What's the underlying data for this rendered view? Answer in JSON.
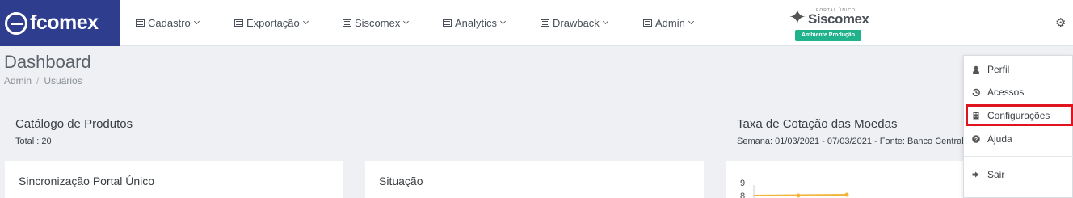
{
  "brand": {
    "logo_text": "fcomex"
  },
  "nav": [
    {
      "label": "Cadastro"
    },
    {
      "label": "Exportação"
    },
    {
      "label": "Siscomex"
    },
    {
      "label": "Analytics"
    },
    {
      "label": "Drawback"
    },
    {
      "label": "Admin"
    }
  ],
  "siscomex": {
    "portal_label": "PORTAL ÚNICO",
    "name": "Siscomex",
    "badge": "Ambiente Produção",
    "badge_color": "#20b28a"
  },
  "settings": {
    "icon": "gear-icon"
  },
  "page": {
    "title": "Dashboard",
    "breadcrumb": [
      "Admin",
      "Usuários"
    ],
    "breadcrumb_sep": "/"
  },
  "catalog": {
    "title": "Catálogo de Produtos",
    "total": "Total : 20"
  },
  "currency": {
    "title": "Taxa de Cotação das Moedas",
    "subtitle": "Semana: 01/03/2021 - 07/03/2021 - Fonte: Banco Central"
  },
  "cards": {
    "sync": {
      "title": "Sincronização Portal Único"
    },
    "status": {
      "title": "Situação"
    },
    "chart_tick_top": "9",
    "chart_tick_next": "8"
  },
  "menu": {
    "items": [
      {
        "label": "Perfil",
        "icon": "user-icon"
      },
      {
        "label": "Acessos",
        "icon": "history-icon"
      },
      {
        "label": "Configurações",
        "icon": "config-icon",
        "highlighted": true
      },
      {
        "label": "Ajuda",
        "icon": "question-icon"
      },
      {
        "label": "Sair",
        "icon": "sign-out-icon"
      }
    ],
    "highlight_color": "#e0141e"
  }
}
